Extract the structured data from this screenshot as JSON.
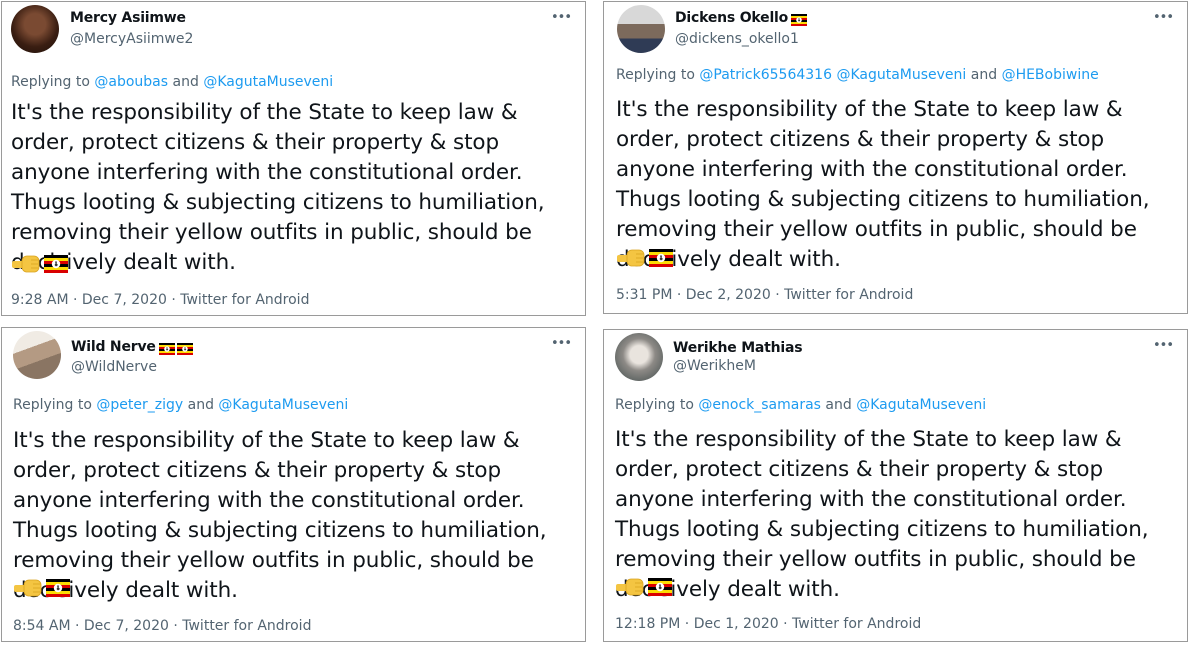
{
  "tweets": [
    {
      "name": "Mercy Asiimwe",
      "name_flags": 0,
      "handle": "@MercyAsiimwe2",
      "replying_label": "Replying to",
      "mentions": [
        "@aboubas",
        "@KagutaMuseveni"
      ],
      "conjunctions": [
        "and"
      ],
      "text": "It's the responsibility of the State to keep law & order, protect citizens & their property & stop anyone interfering with the constitutional order. Thugs looting & subjecting citizens to humiliation, removing their yellow outfits in public, should be decisively dealt with.",
      "time": "9:28 AM",
      "date": "Dec 7, 2020",
      "source": "Twitter for Android"
    },
    {
      "name": "Dickens Okello",
      "name_flags": 1,
      "handle": "@dickens_okello1",
      "replying_label": "Replying to",
      "mentions": [
        "@Patrick65564316",
        "@KagutaMuseveni",
        "@HEBobiwine"
      ],
      "conjunctions": [
        "",
        "and"
      ],
      "text": "It's the responsibility of the State to keep law & order, protect citizens & their property & stop anyone interfering with the constitutional order. Thugs looting & subjecting citizens to humiliation, removing their yellow outfits in public, should be decisively dealt with.",
      "time": "5:31 PM",
      "date": "Dec 2, 2020",
      "source": "Twitter for Android"
    },
    {
      "name": "Wild Nerve",
      "name_flags": 2,
      "handle": "@WildNerve",
      "replying_label": "Replying to",
      "mentions": [
        "@peter_zigy",
        "@KagutaMuseveni"
      ],
      "conjunctions": [
        "and"
      ],
      "text": "It's the responsibility of the State to keep law & order, protect citizens & their property & stop anyone interfering with the constitutional order. Thugs looting & subjecting citizens to humiliation, removing their yellow outfits in public, should be decisively dealt with.",
      "time": "8:54 AM",
      "date": "Dec 7, 2020",
      "source": "Twitter for Android"
    },
    {
      "name": "Werikhe Mathias",
      "name_flags": 0,
      "handle": "@WerikheM",
      "replying_label": "Replying to",
      "mentions": [
        "@enock_samaras",
        "@KagutaMuseveni"
      ],
      "conjunctions": [
        "and"
      ],
      "text": "It's the responsibility of the State to keep law & order, protect citizens & their property & stop anyone interfering with the constitutional order. Thugs looting & subjecting citizens to humiliation, removing their yellow outfits in public, should be decisively dealt with.",
      "time": "12:18 PM",
      "date": "Dec 1, 2020",
      "source": "Twitter for Android"
    }
  ],
  "separator": "·",
  "more_icon": "•••",
  "icons": {
    "emoji_1": "raised-fist-icon",
    "emoji_2": "uganda-flag-icon",
    "more": "more-options-icon"
  },
  "colors": {
    "link": "#1d9bf0",
    "muted": "#536471",
    "text": "#0f1419",
    "fist": "#f4c542"
  }
}
